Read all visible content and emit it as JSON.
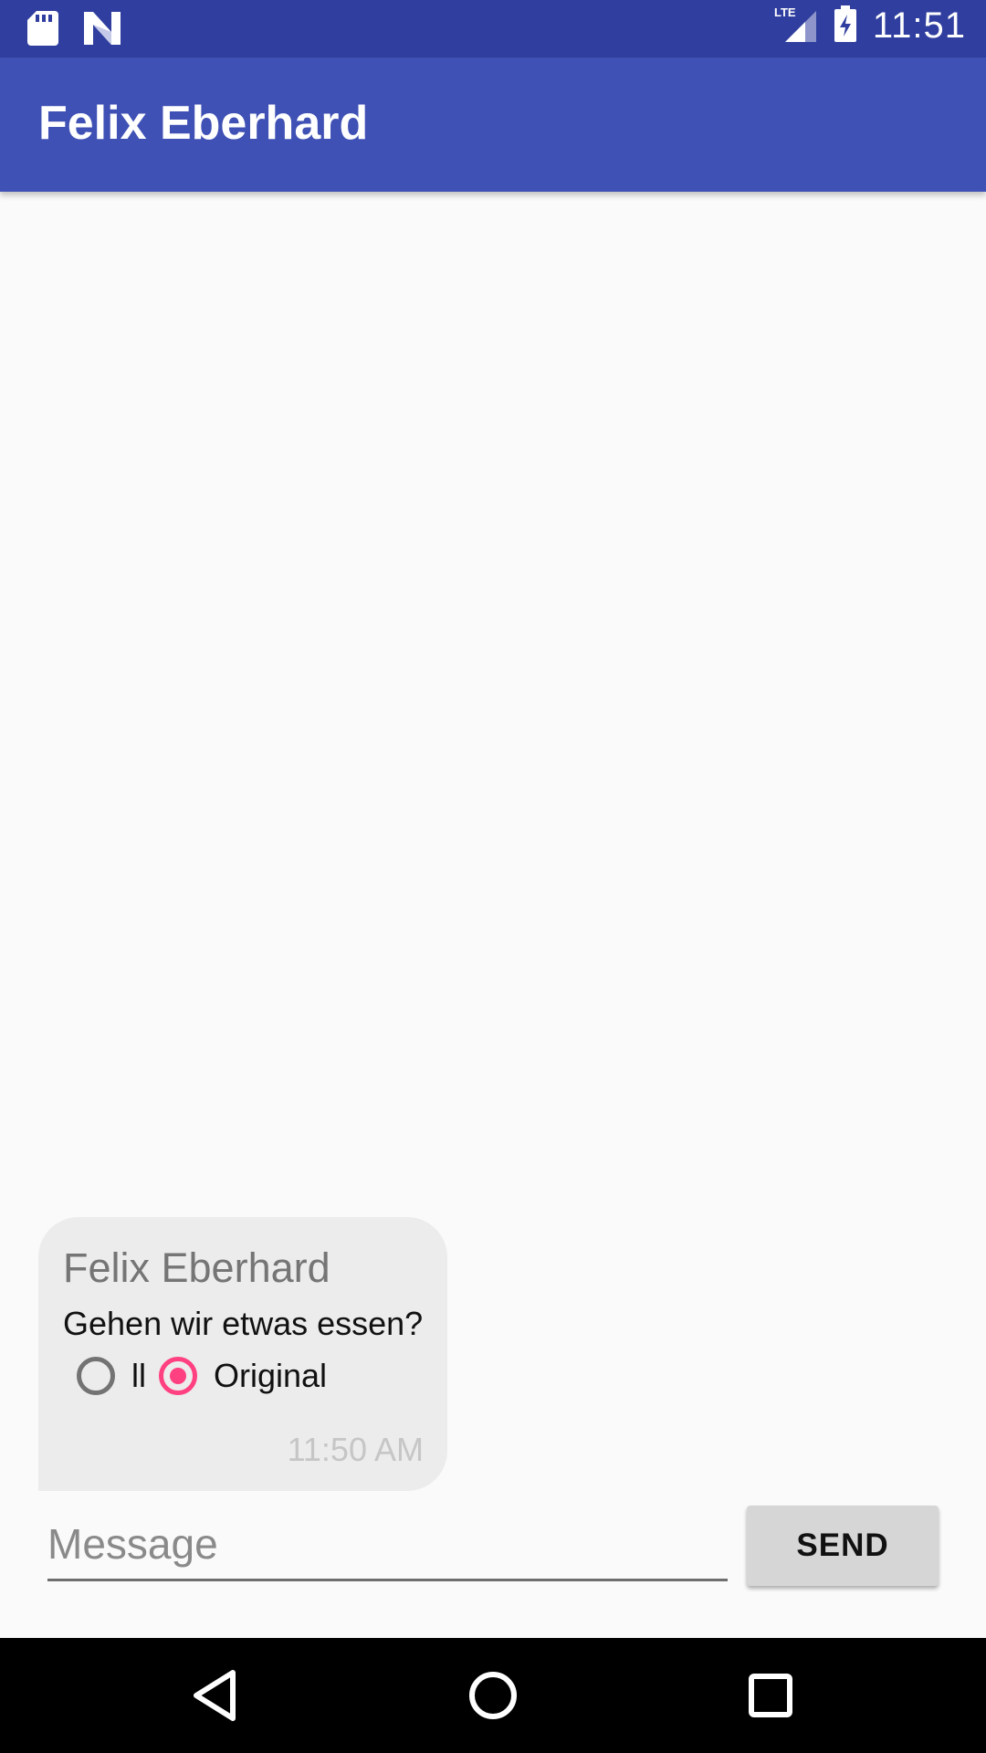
{
  "status_bar": {
    "time": "11:51",
    "network": "LTE",
    "left_icons": [
      "sd-card-icon",
      "app-notification-icon"
    ],
    "right_icons": [
      "lte-signal-icon",
      "battery-charging-icon"
    ],
    "color": "#303f9f"
  },
  "app_bar": {
    "title": "Felix Eberhard",
    "color": "#3f51b5"
  },
  "message": {
    "sender": "Felix Eberhard",
    "text": "Gehen wir etwas essen?",
    "options": [
      {
        "label": "ll",
        "selected": false
      },
      {
        "label": "Original",
        "selected": true
      }
    ],
    "time": "11:50 AM",
    "accent_color": "#ff4081"
  },
  "composer": {
    "placeholder": "Message",
    "value": "",
    "send_label": "SEND"
  },
  "nav_bar": {
    "buttons": [
      "back-icon",
      "home-icon",
      "recents-icon"
    ]
  }
}
